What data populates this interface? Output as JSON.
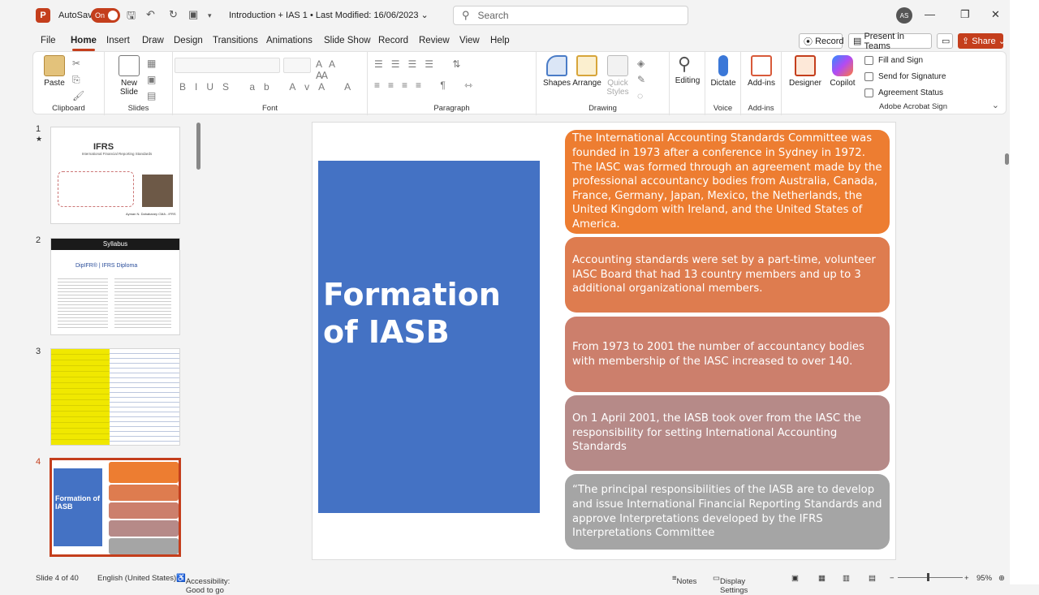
{
  "titlebar": {
    "app_logo": "P",
    "autosave_label": "AutoSave",
    "autosave_state": "On",
    "doc_title": "Introduction + IAS 1 • Last Modified: 16/06/2023",
    "search_placeholder": "Search",
    "user_initials": "AS"
  },
  "menu": {
    "tabs": [
      "File",
      "Home",
      "Insert",
      "Draw",
      "Design",
      "Transitions",
      "Animations",
      "Slide Show",
      "Record",
      "Review",
      "View",
      "Help"
    ],
    "record_btn": "Record",
    "present_btn": "Present in Teams",
    "share_btn": "Share"
  },
  "ribbon": {
    "clipboard": {
      "paste": "Paste",
      "label": "Clipboard"
    },
    "slides": {
      "new_slide": "New Slide",
      "label": "Slides"
    },
    "font": {
      "label": "Font"
    },
    "paragraph": {
      "label": "Paragraph"
    },
    "drawing": {
      "shapes": "Shapes",
      "arrange": "Arrange",
      "quick_styles": "Quick Styles",
      "label": "Drawing"
    },
    "editing": {
      "label": "Editing"
    },
    "voice": {
      "dictate": "Dictate",
      "label": "Voice"
    },
    "addins": {
      "addins": "Add-ins",
      "label": "Add-ins"
    },
    "designer": "Designer",
    "copilot": "Copilot",
    "acrobat": {
      "fill_sign": "Fill and Sign",
      "send_sig": "Send for Signature",
      "agreement": "Agreement Status",
      "label": "Adobe Acrobat Sign"
    }
  },
  "thumbnails": [
    {
      "num": "1",
      "star": "★",
      "title": "IFRS",
      "subtitle": "International Financial Reporting Standards",
      "caption": "Ayman N. Dahabaney CMA - IFRS"
    },
    {
      "num": "2",
      "header": "Syllabus",
      "title": "DipIFR® | IFRS Diploma"
    },
    {
      "num": "3"
    },
    {
      "num": "4",
      "title": "Formation of IASB"
    }
  ],
  "slide": {
    "title": "Formation of IASB",
    "boxes": [
      {
        "text": "The International Accounting Standards Committee was founded in 1973 after a conference in Sydney in 1972. The IASC was formed through an agreement made by the professional accountancy bodies from Australia, Canada, France, Germany, Japan, Mexico, the Netherlands, the United Kingdom with Ireland, and the United States of America.",
        "color": "#ed7d31"
      },
      {
        "text": "Accounting standards were set by a part-time, volunteer IASC Board that had 13 country members and up to 3 additional organizational members.",
        "color": "#de7c4f"
      },
      {
        "text": "From 1973 to 2001 the number of accountancy bodies with membership of the IASC increased to over 140.",
        "color": "#cc7f6c"
      },
      {
        "text": "On 1 April 2001, the IASB took over from the IASC the responsibility for setting International Accounting Standards",
        "color": "#b68a88"
      },
      {
        "text": "“The principal responsibilities of the IASB are to develop and issue International Financial Reporting Standards and approve Interpretations developed by the IFRS Interpretations Committee",
        "color": "#a5a5a5"
      }
    ]
  },
  "status": {
    "slide_pos": "Slide 4 of 40",
    "language": "English (United States)",
    "accessibility": "Accessibility: Good to go",
    "notes": "Notes",
    "display": "Display Settings",
    "zoom": "95%"
  }
}
